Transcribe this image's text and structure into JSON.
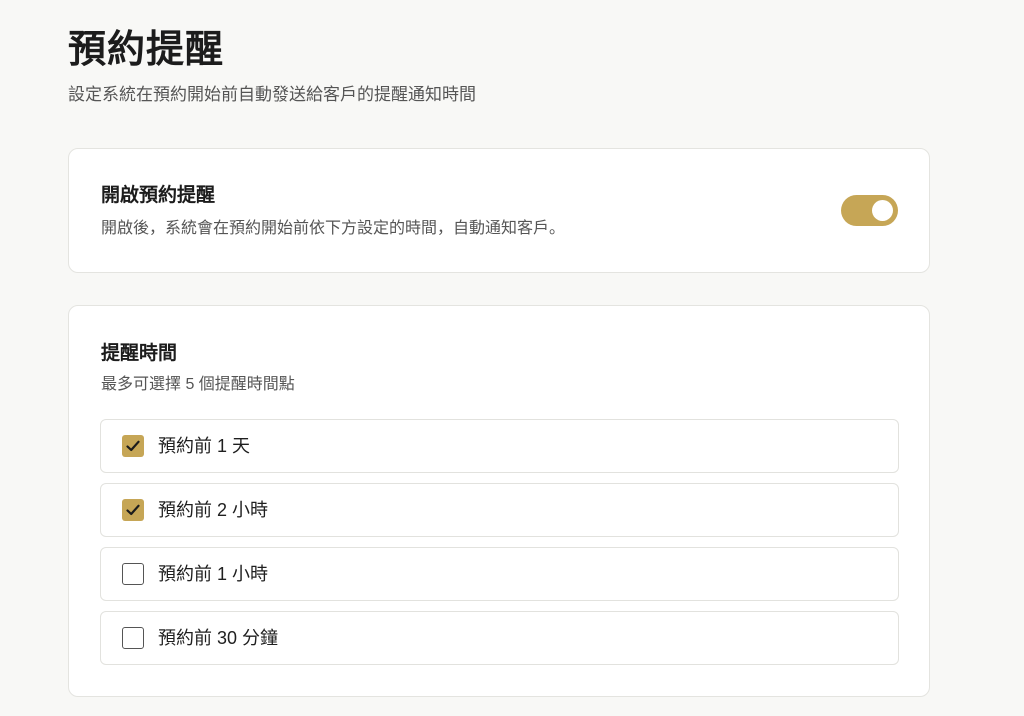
{
  "header": {
    "title": "預約提醒",
    "subtitle": "設定系統在預約開始前自動發送給客戶的提醒通知時間"
  },
  "enable_card": {
    "title": "開啟預約提醒",
    "description": "開啟後，系統會在預約開始前依下方設定的時間，自動通知客戶。",
    "toggle_on": true
  },
  "times_card": {
    "title": "提醒時間",
    "hint": "最多可選擇 5 個提醒時間點",
    "options": [
      {
        "label": "預約前 1 天",
        "checked": true
      },
      {
        "label": "預約前 2 小時",
        "checked": true
      },
      {
        "label": "預約前 1 小時",
        "checked": false
      },
      {
        "label": "預約前 30 分鐘",
        "checked": false
      }
    ]
  },
  "colors": {
    "accent": "#c6a656",
    "background": "#f8f8f6",
    "card": "#ffffff"
  },
  "icons": {
    "checkmark": "check-icon"
  }
}
